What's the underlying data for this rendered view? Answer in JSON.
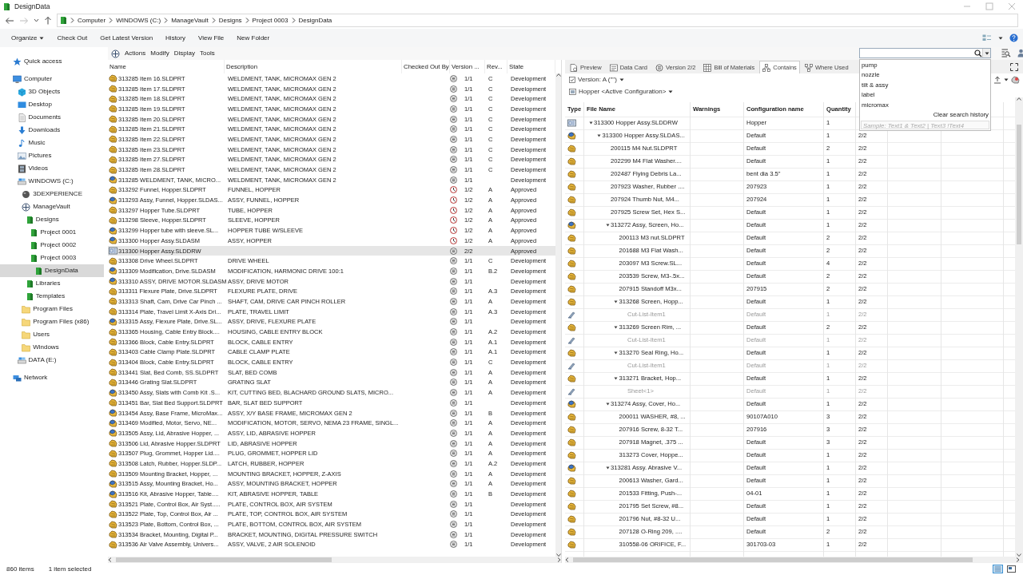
{
  "window": {
    "title": "DesignData"
  },
  "address_bar": {
    "segments": [
      "Computer",
      "WINDOWS (C:)",
      "ManageVault",
      "Designs",
      "Project 0003",
      "DesignData"
    ]
  },
  "toolbar": {
    "items": [
      {
        "label": "Organize",
        "dropdown": true
      },
      {
        "label": "Check Out",
        "dropdown": false
      },
      {
        "label": "Get Latest Version",
        "dropdown": false
      },
      {
        "label": "History",
        "dropdown": false
      },
      {
        "label": "View File",
        "dropdown": false
      },
      {
        "label": "New Folder",
        "dropdown": false
      }
    ]
  },
  "navigation": {
    "items": [
      {
        "label": "Quick access",
        "kind": "star",
        "selected": false
      },
      {
        "label": "Computer",
        "kind": "computer",
        "selected": false,
        "children": [
          {
            "label": "3D Objects",
            "kind": "cube",
            "selected": false
          },
          {
            "label": "Desktop",
            "kind": "desktop",
            "selected": false
          },
          {
            "label": "Documents",
            "kind": "documents",
            "selected": false
          },
          {
            "label": "Downloads",
            "kind": "downloads",
            "selected": false
          },
          {
            "label": "Music",
            "kind": "music",
            "selected": false
          },
          {
            "label": "Pictures",
            "kind": "pictures",
            "selected": false
          },
          {
            "label": "Videos",
            "kind": "videos",
            "selected": false
          },
          {
            "label": "WINDOWS (C:)",
            "kind": "drive",
            "selected": false,
            "children": [
              {
                "label": "3DEXPERIENCE",
                "kind": "sphere",
                "selected": false
              },
              {
                "label": "ManageVault",
                "kind": "vault",
                "selected": false,
                "children": [
                  {
                    "label": "Designs",
                    "kind": "vault_folder",
                    "selected": false,
                    "children": [
                      {
                        "label": "Project 0001",
                        "kind": "vault_folder",
                        "selected": false
                      },
                      {
                        "label": "Project 0002",
                        "kind": "vault_folder",
                        "selected": false
                      },
                      {
                        "label": "Project 0003",
                        "kind": "vault_folder",
                        "selected": false,
                        "children": [
                          {
                            "label": "DesignData",
                            "kind": "vault_folder",
                            "selected": true
                          }
                        ]
                      }
                    ]
                  },
                  {
                    "label": "Libraries",
                    "kind": "vault_folder",
                    "selected": false
                  },
                  {
                    "label": "Templates",
                    "kind": "vault_folder",
                    "selected": false
                  }
                ]
              },
              {
                "label": "Program Files",
                "kind": "folder",
                "selected": false
              },
              {
                "label": "Program Files (x86)",
                "kind": "folder",
                "selected": false
              },
              {
                "label": "Users",
                "kind": "folder",
                "selected": false
              },
              {
                "label": "Windows",
                "kind": "folder",
                "selected": false
              }
            ]
          },
          {
            "label": "DATA (E:)",
            "kind": "drive",
            "selected": false
          }
        ]
      },
      {
        "label": "Network",
        "kind": "network",
        "selected": false
      }
    ]
  },
  "file_list": {
    "menu": [
      "Actions",
      "Modify",
      "Display",
      "Tools"
    ],
    "columns": [
      "Name",
      "Description",
      "Checked Out By",
      "Version ...",
      "Rev...",
      "State"
    ],
    "rows": [
      {
        "kind": "part",
        "name": "313285 Item 16.SLDPRT",
        "description": "WELDMENT, TANK, MICROMAX GEN 2",
        "status_icon": {
          "kind": "development"
        },
        "version": "1/1",
        "rev": "C",
        "state": "Development",
        "selected": false
      },
      {
        "kind": "part",
        "name": "313285 Item 17.SLDPRT",
        "description": "WELDMENT, TANK, MICROMAX GEN 2",
        "status_icon": {
          "kind": "development"
        },
        "version": "1/1",
        "rev": "C",
        "state": "Development",
        "selected": false
      },
      {
        "kind": "part",
        "name": "313285 Item 18.SLDPRT",
        "description": "WELDMENT, TANK, MICROMAX GEN 2",
        "status_icon": {
          "kind": "development"
        },
        "version": "1/1",
        "rev": "C",
        "state": "Development",
        "selected": false
      },
      {
        "kind": "part",
        "name": "313285 Item 19.SLDPRT",
        "description": "WELDMENT, TANK, MICROMAX GEN 2",
        "status_icon": {
          "kind": "development"
        },
        "version": "1/1",
        "rev": "C",
        "state": "Development",
        "selected": false
      },
      {
        "kind": "part",
        "name": "313285 Item 20.SLDPRT",
        "description": "WELDMENT, TANK, MICROMAX GEN 2",
        "status_icon": {
          "kind": "development"
        },
        "version": "1/1",
        "rev": "C",
        "state": "Development",
        "selected": false
      },
      {
        "kind": "part",
        "name": "313285 Item 21.SLDPRT",
        "description": "WELDMENT, TANK, MICROMAX GEN 2",
        "status_icon": {
          "kind": "development"
        },
        "version": "1/1",
        "rev": "C",
        "state": "Development",
        "selected": false
      },
      {
        "kind": "part",
        "name": "313285 Item 22.SLDPRT",
        "description": "WELDMENT, TANK, MICROMAX GEN 2",
        "status_icon": {
          "kind": "development"
        },
        "version": "1/1",
        "rev": "C",
        "state": "Development",
        "selected": false
      },
      {
        "kind": "part",
        "name": "313285 Item 23.SLDPRT",
        "description": "WELDMENT, TANK, MICROMAX GEN 2",
        "status_icon": {
          "kind": "development"
        },
        "version": "1/1",
        "rev": "C",
        "state": "Development",
        "selected": false
      },
      {
        "kind": "part",
        "name": "313285 Item 27.SLDPRT",
        "description": "WELDMENT, TANK, MICROMAX GEN 2",
        "status_icon": {
          "kind": "development"
        },
        "version": "1/1",
        "rev": "C",
        "state": "Development",
        "selected": false
      },
      {
        "kind": "part",
        "name": "313285 Item 28.SLDPRT",
        "description": "WELDMENT, TANK, MICROMAX GEN 2",
        "status_icon": {
          "kind": "development"
        },
        "version": "1/1",
        "rev": "C",
        "state": "Development",
        "selected": false
      },
      {
        "kind": "assembly",
        "name": "313285 WELDMENT, TANK, MICRO...",
        "description": "WELDMENT, TANK, MICROMAX GEN 2",
        "status_icon": {
          "kind": "development"
        },
        "version": "1/1",
        "state": "Development",
        "selected": false
      },
      {
        "kind": "part",
        "name": "313292 Funnel, Hopper.SLDPRT",
        "description": "FUNNEL, HOPPER",
        "status_icon": {
          "kind": "approved"
        },
        "version": "1/2",
        "rev": "A",
        "state": "Approved",
        "selected": false
      },
      {
        "kind": "assembly",
        "name": "313293 Assy, Funnel, Hopper.SLDAS...",
        "description": "ASSY, FUNNEL, HOPPER",
        "status_icon": {
          "kind": "approved"
        },
        "version": "1/2",
        "rev": "A",
        "state": "Approved",
        "selected": false
      },
      {
        "kind": "part",
        "name": "313297 Hopper Tube.SLDPRT",
        "description": "TUBE, HOPPER",
        "status_icon": {
          "kind": "approved"
        },
        "version": "1/2",
        "rev": "A",
        "state": "Approved",
        "selected": false
      },
      {
        "kind": "part",
        "name": "313298 Sleeve, Hopper.SLDPRT",
        "description": "SLEEVE, HOPPER",
        "status_icon": {
          "kind": "approved"
        },
        "version": "1/2",
        "rev": "A",
        "state": "Approved",
        "selected": false
      },
      {
        "kind": "assembly",
        "name": "313299 Hopper tube with sleeve.SL...",
        "description": "HOPPER TUBE W/SLEEVE",
        "status_icon": {
          "kind": "approved"
        },
        "version": "1/2",
        "rev": "A",
        "state": "Approved",
        "selected": false
      },
      {
        "kind": "assembly",
        "name": "313300 Hopper Assy.SLDASM",
        "description": "ASSY, HOPPER",
        "status_icon": {
          "kind": "approved"
        },
        "version": "1/2",
        "rev": "A",
        "state": "Approved",
        "selected": false
      },
      {
        "kind": "drawing",
        "name": "313300 Hopper Assy.SLDDRW",
        "status_icon": {
          "kind": "development"
        },
        "version": "2/2",
        "state": "Approved",
        "selected": true
      },
      {
        "kind": "part",
        "name": "313308 Drive Wheel.SLDPRT",
        "description": "DRIVE WHEEL",
        "status_icon": {
          "kind": "development"
        },
        "version": "1/1",
        "rev": "C",
        "state": "Development",
        "selected": false
      },
      {
        "kind": "assembly",
        "name": "313309 Modification, Drive.SLDASM",
        "description": "MODIFICATION, HARMONIC DRIVE 100:1",
        "status_icon": {
          "kind": "development"
        },
        "version": "1/1",
        "rev": "B.2",
        "state": "Development",
        "selected": false
      },
      {
        "kind": "assembly",
        "name": "313310 ASSY, DRIVE MOTOR.SLDASM",
        "description": "ASSY, DRIVE MOTOR",
        "status_icon": {
          "kind": "development"
        },
        "version": "1/1",
        "state": "Development",
        "selected": false
      },
      {
        "kind": "part",
        "name": "313311 Flexure Plate, Drive.SLDPRT",
        "description": "FLEXURE PLATE, DRIVE",
        "status_icon": {
          "kind": "development"
        },
        "version": "1/1",
        "rev": "A.3",
        "state": "Development",
        "selected": false
      },
      {
        "kind": "part",
        "name": "313313 Shaft, Cam, Drive Car Pinch ...",
        "description": "SHAFT, CAM, DRIVE CAR PINCH ROLLER",
        "status_icon": {
          "kind": "development"
        },
        "version": "1/1",
        "rev": "A",
        "state": "Development",
        "selected": false
      },
      {
        "kind": "part",
        "name": "313314 Plate, Travel Limit X-Axis Dri...",
        "description": "PLATE, TRAVEL LIMIT",
        "status_icon": {
          "kind": "development"
        },
        "version": "1/1",
        "rev": "A.3",
        "state": "Development",
        "selected": false
      },
      {
        "kind": "assembly",
        "name": "313315 Assy, Flexure Plate, Drive.SL...",
        "description": "ASSY, DRIVE, FLEXURE PLATE",
        "status_icon": {
          "kind": "development"
        },
        "version": "1/1",
        "state": "Development",
        "selected": false
      },
      {
        "kind": "part",
        "name": "313365 Housing, Cable Entry Block....",
        "description": "HOUSING, CABLE ENTRY BLOCK",
        "status_icon": {
          "kind": "development"
        },
        "version": "1/1",
        "rev": "A.2",
        "state": "Development",
        "selected": false
      },
      {
        "kind": "part",
        "name": "313366 Block, Cable Entry.SLDPRT",
        "description": "BLOCK, CABLE ENTRY",
        "status_icon": {
          "kind": "development"
        },
        "version": "1/1",
        "rev": "A.1",
        "state": "Development",
        "selected": false
      },
      {
        "kind": "part",
        "name": "313403 Cable Clamp Plate.SLDPRT",
        "description": "CABLE CLAMP PLATE",
        "status_icon": {
          "kind": "development"
        },
        "version": "1/1",
        "rev": "A.1",
        "state": "Development",
        "selected": false
      },
      {
        "kind": "part",
        "name": "313404 Block, Cable Entry.SLDPRT",
        "description": "BLOCK, CABLE ENTRY",
        "status_icon": {
          "kind": "development"
        },
        "version": "1/1",
        "rev": "C",
        "state": "Development",
        "selected": false
      },
      {
        "kind": "part",
        "name": "313441 Slat, Bed Comb, SS.SLDPRT",
        "description": "SLAT, BED COMB",
        "status_icon": {
          "kind": "development"
        },
        "version": "1/1",
        "rev": "A",
        "state": "Development",
        "selected": false
      },
      {
        "kind": "part",
        "name": "313446 Grating Slat.SLDPRT",
        "description": "GRATING SLAT",
        "status_icon": {
          "kind": "development"
        },
        "version": "1/1",
        "rev": "A",
        "state": "Development",
        "selected": false
      },
      {
        "kind": "assembly",
        "name": "313450 Assy, Slats with Comb Kit .S...",
        "description": "KIT, CUTTING BED, BLACHARD GROUND SLATS, MICRO...",
        "status_icon": {
          "kind": "development"
        },
        "version": "1/1",
        "rev": "A",
        "state": "Development",
        "selected": false
      },
      {
        "kind": "part",
        "name": "313451 Bar, Slat Bed Support.SLDPRT",
        "description": "BAR, SLAT BED SUPPORT",
        "status_icon": {
          "kind": "development"
        },
        "version": "1/1",
        "state": "Development",
        "selected": false
      },
      {
        "kind": "assembly",
        "name": "313454 Assy, Base Frame, MicroMax...",
        "description": "ASSY, X/Y BASE FRAME, MICROMAX GEN 2",
        "status_icon": {
          "kind": "development"
        },
        "version": "1/1",
        "rev": "B",
        "state": "Development",
        "selected": false
      },
      {
        "kind": "assembly",
        "name": "313469 Modified, Motor, Servo, NE...",
        "description": "MODIFICATION, MOTOR, SERVO, NEMA 23 FRAME, SINGL...",
        "status_icon": {
          "kind": "development"
        },
        "version": "1/1",
        "rev": "A",
        "state": "Development",
        "selected": false
      },
      {
        "kind": "assembly",
        "name": "313505 Assy, Lid, Abrasive Hopper, ...",
        "description": "ASSY, LID, ABRASIVE HOPPER",
        "status_icon": {
          "kind": "development"
        },
        "version": "1/1",
        "rev": "A",
        "state": "Development",
        "selected": false
      },
      {
        "kind": "part",
        "name": "313506 Lid, Abrasive Hopper.SLDPRT",
        "description": "LID, ABRASIVE HOPPER",
        "status_icon": {
          "kind": "development"
        },
        "version": "1/1",
        "rev": "A",
        "state": "Development",
        "selected": false
      },
      {
        "kind": "part",
        "name": "313507 Plug, Grommet, Hopper Lid....",
        "description": "PLUG, GROMMET, HOPPER LID",
        "status_icon": {
          "kind": "development"
        },
        "version": "1/1",
        "rev": "A",
        "state": "Development",
        "selected": false
      },
      {
        "kind": "part",
        "name": "313508 Latch, Rubber, Hopper.SLDP...",
        "description": "LATCH, RUBBER, HOPPER",
        "status_icon": {
          "kind": "development"
        },
        "version": "1/1",
        "rev": "A.2",
        "state": "Development",
        "selected": false
      },
      {
        "kind": "part",
        "name": "313509 Mounting Bracket, Hopper, ...",
        "description": "MOUNTING BRACKET, HOPPER, Z-AXIS",
        "status_icon": {
          "kind": "development"
        },
        "version": "1/1",
        "rev": "A",
        "state": "Development",
        "selected": false
      },
      {
        "kind": "assembly",
        "name": "313515 Assy, Mounting Bracket, Ho...",
        "description": "ASSY, MOUNTING BRACKET, HOPPER",
        "status_icon": {
          "kind": "development"
        },
        "version": "1/1",
        "rev": "A",
        "state": "Development",
        "selected": false
      },
      {
        "kind": "assembly",
        "name": "313516 Kit, Abrasive Hopper, Table....",
        "description": "KIT, ABRASIVE HOPPER, TABLE",
        "status_icon": {
          "kind": "development"
        },
        "version": "1/1",
        "rev": "B",
        "state": "Development",
        "selected": false
      },
      {
        "kind": "part",
        "name": "313521 Plate, Control Box, Air Syst.....",
        "description": "PLATE, CONTROL BOX, AIR SYSTEM",
        "status_icon": {
          "kind": "development"
        },
        "version": "1/1",
        "state": "Development",
        "selected": false
      },
      {
        "kind": "part",
        "name": "313522 Plate, Top, Control Box, Air ...",
        "description": "PLATE, TOP, CONTROL BOX, AIR SYSTEM",
        "status_icon": {
          "kind": "development"
        },
        "version": "1/1",
        "state": "Development",
        "selected": false
      },
      {
        "kind": "part",
        "name": "313523 Plate, Bottom, Control Box, ...",
        "description": "PLATE, BOTTOM, CONTROL BOX, AIR SYSTEM",
        "status_icon": {
          "kind": "development"
        },
        "version": "1/1",
        "state": "Development",
        "selected": false
      },
      {
        "kind": "part",
        "name": "313534 Bracket, Mounting, Digital P...",
        "description": "BRACKET, MOUNTING, DIGITAL PRESSURE SWITCH",
        "status_icon": {
          "kind": "development"
        },
        "version": "1/1",
        "state": "Development",
        "selected": false
      },
      {
        "kind": "part",
        "name": "313536 Air Valve Assembly, Univers...",
        "description": "ASSY, VALVE, 2 AIR SOLENOID",
        "status_icon": {
          "kind": "development"
        },
        "version": "1/1",
        "state": "Development",
        "selected": false
      }
    ]
  },
  "search": {
    "history": [
      "pump",
      "nozzle",
      "tilt & assy",
      "label",
      "micromax"
    ],
    "clear_label": "Clear search history",
    "hint": "Sample: Text1 & Text2 | Text3 !Text4"
  },
  "preview_pane": {
    "tabs": [
      {
        "label": "Preview",
        "selected": false
      },
      {
        "label": "Data Card",
        "selected": false
      },
      {
        "label": "Version 2/2",
        "selected": false
      },
      {
        "label": "Bill of Materials",
        "selected": false
      },
      {
        "label": "Contains",
        "selected": true
      },
      {
        "label": "Where Used",
        "selected": false
      }
    ],
    "version": "Version: A (\"\")",
    "configuration": "Hopper <Active Configuration>",
    "columns": [
      "Type",
      "File Name",
      "Warnings",
      "Configuration name",
      "Quantity"
    ],
    "rows": [
      {
        "kind": "drawing",
        "file_name": "313300 Hopper Assy.SLDDRW",
        "configuration": "Hopper",
        "quantity": "1",
        "expanded": true,
        "children": [
          {
            "kind": "assembly",
            "file_name": "313300 Hopper Assy.SLDAS...",
            "configuration": "Default",
            "quantity": "1",
            "column_6": "2/2",
            "expanded": true,
            "children": [
              {
                "kind": "part",
                "file_name": "200115 M4 Nut.SLDPRT",
                "configuration": "Default",
                "quantity": "2",
                "column_6": "2/2"
              },
              {
                "kind": "part",
                "file_name": "202299 M4 Flat Washer....",
                "configuration": "Default",
                "quantity": "1",
                "column_6": "2/2"
              },
              {
                "kind": "part",
                "file_name": "202487 Flying Debris La...",
                "configuration": "bent dia 3.5\"",
                "quantity": "1",
                "column_6": "2/2"
              },
              {
                "kind": "part",
                "file_name": "207923 Washer, Rubber ....",
                "configuration": "207923",
                "quantity": "1",
                "column_6": "2/2"
              },
              {
                "kind": "part",
                "file_name": "207924 Thumb Nut, M4...",
                "configuration": "207924",
                "quantity": "1",
                "column_6": "2/2"
              },
              {
                "kind": "part",
                "file_name": "207925 Screw Set, Hex S...",
                "configuration": "Default",
                "quantity": "1",
                "column_6": "2/2"
              },
              {
                "kind": "assembly",
                "file_name": "313272 Assy, Screen, Ho...",
                "configuration": "Default",
                "quantity": "1",
                "column_6": "2/2",
                "expanded": true,
                "children": [
                  {
                    "kind": "part",
                    "file_name": "200113 M3 nut.SLDPRT",
                    "configuration": "Default",
                    "quantity": "2",
                    "column_6": "2/2"
                  },
                  {
                    "kind": "part",
                    "file_name": "201688 M3 Flat Wash...",
                    "configuration": "Default",
                    "quantity": "2",
                    "column_6": "2/2"
                  },
                  {
                    "kind": "part",
                    "file_name": "203097 M3 Screw.SL...",
                    "configuration": "Default",
                    "quantity": "4",
                    "column_6": "2/2"
                  },
                  {
                    "kind": "part",
                    "file_name": "203539 Screw, M3-.5x...",
                    "configuration": "Default",
                    "quantity": "2",
                    "column_6": "2/2"
                  },
                  {
                    "kind": "part",
                    "file_name": "207915 Standoff M3x...",
                    "configuration": "207915",
                    "quantity": "2",
                    "column_6": "2/2"
                  },
                  {
                    "kind": "part",
                    "file_name": "313268 Screen, Hopp...",
                    "configuration": "Default",
                    "quantity": "1",
                    "column_6": "2/2",
                    "expanded": true,
                    "children": [
                      {
                        "kind": "cutlist",
                        "file_name": "Cut-List-Item1",
                        "configuration": "Default",
                        "quantity": "1",
                        "column_6": "2/2"
                      }
                    ]
                  },
                  {
                    "kind": "part",
                    "file_name": "313269 Screen Rim, ...",
                    "configuration": "Default",
                    "quantity": "2",
                    "column_6": "2/2",
                    "expanded": true,
                    "children": [
                      {
                        "kind": "cutlist",
                        "file_name": "Cut-List-Item1",
                        "configuration": "Default",
                        "quantity": "1",
                        "column_6": "2/2"
                      }
                    ]
                  },
                  {
                    "kind": "part",
                    "file_name": "313270 Seal Ring, Ho...",
                    "configuration": "Default",
                    "quantity": "1",
                    "column_6": "2/2",
                    "expanded": true,
                    "children": [
                      {
                        "kind": "cutlist",
                        "file_name": "Cut-List-Item1",
                        "configuration": "Default",
                        "quantity": "1",
                        "column_6": "2/2"
                      }
                    ]
                  },
                  {
                    "kind": "part",
                    "file_name": "313271 Bracket, Hop...",
                    "configuration": "Default",
                    "quantity": "1",
                    "column_6": "2/2",
                    "expanded": true,
                    "children": [
                      {
                        "kind": "cutlist",
                        "file_name": "Sheet<1>",
                        "configuration": "Default",
                        "quantity": "1",
                        "column_6": "2/2"
                      }
                    ]
                  }
                ]
              },
              {
                "kind": "assembly",
                "file_name": "313274 Assy, Cover, Ho...",
                "configuration": "Default",
                "quantity": "1",
                "column_6": "2/2",
                "expanded": true,
                "children": [
                  {
                    "kind": "part",
                    "file_name": "200011 WASHER, #8, ...",
                    "configuration": "90107A010",
                    "quantity": "3",
                    "column_6": "2/2"
                  },
                  {
                    "kind": "part",
                    "file_name": "207916 Screw, 8-32 T...",
                    "configuration": "207916",
                    "quantity": "3",
                    "column_6": "2/2"
                  },
                  {
                    "kind": "part",
                    "file_name": "207918 Magnet, .375 ...",
                    "configuration": "Default",
                    "quantity": "3",
                    "column_6": "2/2"
                  },
                  {
                    "kind": "part",
                    "file_name": "313273 Cover, Hoppe...",
                    "configuration": "Default",
                    "quantity": "1",
                    "column_6": "2/2"
                  }
                ]
              },
              {
                "kind": "assembly",
                "file_name": "313281 Assy. Abrasive V...",
                "configuration": "Default",
                "quantity": "1",
                "column_6": "2/2",
                "expanded": true,
                "children": [
                  {
                    "kind": "part",
                    "file_name": "200613 Washer, Gard...",
                    "configuration": "Default",
                    "quantity": "1",
                    "column_6": "2/2"
                  },
                  {
                    "kind": "part",
                    "file_name": "201533 Fitting, Push-...",
                    "configuration": "04-01",
                    "quantity": "1",
                    "column_6": "2/2"
                  },
                  {
                    "kind": "part",
                    "file_name": "201795 Set Screw, #8...",
                    "configuration": "Default",
                    "quantity": "1",
                    "column_6": "2/2"
                  },
                  {
                    "kind": "part",
                    "file_name": "201796 Nut, #8-32 U...",
                    "configuration": "Default",
                    "quantity": "1",
                    "column_6": "2/2"
                  },
                  {
                    "kind": "part",
                    "file_name": "207128 O-Ring 209, ....",
                    "configuration": "Default",
                    "quantity": "2",
                    "column_6": "2/2"
                  },
                  {
                    "kind": "part",
                    "file_name": "310558-06 ORIFICE, F...",
                    "configuration": "301703-03",
                    "quantity": "1",
                    "column_6": "2/2"
                  }
                ]
              }
            ]
          }
        ]
      }
    ]
  },
  "status_bar": {
    "item_count": "860 items",
    "selection": "1 item selected"
  }
}
